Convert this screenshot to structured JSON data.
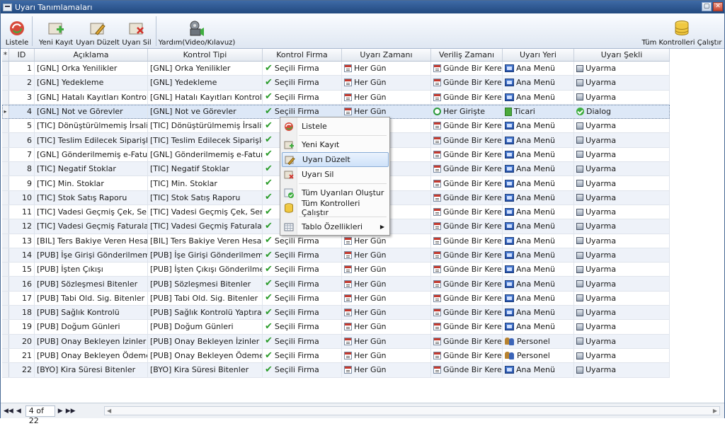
{
  "window": {
    "title": "Uyarı Tanımlamaları"
  },
  "toolbar": {
    "listele": "Listele",
    "yeni_kayit": "Yeni Kayıt",
    "uyari_duzelt": "Uyarı Düzelt",
    "uyari_sil": "Uyarı Sil",
    "yardim": "Yardım(Video/Kılavuz)",
    "tum_kontroller": "Tüm Kontrolleri Çalıştır"
  },
  "grid": {
    "new_row_marker": "*",
    "current_row_marker": "▸",
    "columns": [
      "ID",
      "Açıklama",
      "Kontrol Tipi",
      "Kontrol Firma",
      "Uyarı Zamanı",
      "Veriliş Zamanı",
      "Uyarı Yeri",
      "Uyarı Şekli"
    ],
    "rows": [
      {
        "id": "1",
        "aciklama": "[GNL] Orka Yenilikler",
        "tip": "[GNL] Orka Yenilikler",
        "firma": "Seçili Firma",
        "zaman": "Her Gün",
        "verilis": "Günde Bir Kere",
        "yer": "Ana Menü",
        "sekil": "Uyarma"
      },
      {
        "id": "2",
        "aciklama": "[GNL] Yedekleme",
        "tip": "[GNL] Yedekleme",
        "firma": "Seçili Firma",
        "zaman": "Her Gün",
        "verilis": "Günde Bir Kere",
        "yer": "Ana Menü",
        "sekil": "Uyarma"
      },
      {
        "id": "3",
        "aciklama": "[GNL] Hatalı Kayıtları Kontrol Et",
        "tip": "[GNL] Hatalı Kayıtları Kontrol Et",
        "firma": "Seçili Firma",
        "zaman": "Her Gün",
        "verilis": "Günde Bir Kere",
        "yer": "Ana Menü",
        "sekil": "Uyarma"
      },
      {
        "id": "4",
        "aciklama": "[GNL] Not ve Görevler",
        "tip": "[GNL] Not ve Görevler",
        "firma": "Seçili Firma",
        "zaman": "Her Gün",
        "verilis": "Her Girişte",
        "yer": "Ticari",
        "sekil": "Dialog"
      },
      {
        "id": "5",
        "aciklama": "[TIC] Dönüştürülmemiş İrsaliyeler",
        "tip": "[TIC] Dönüştürülmemiş İrsaliyeler",
        "firma": "",
        "zaman": "",
        "verilis": "Günde Bir Kere",
        "yer": "Ana Menü",
        "sekil": "Uyarma"
      },
      {
        "id": "6",
        "aciklama": "[TIC] Teslim Edilecek Siparişler",
        "tip": "[TIC] Teslim Edilecek Siparişler",
        "firma": "",
        "zaman": "",
        "verilis": "Günde Bir Kere",
        "yer": "Ana Menü",
        "sekil": "Uyarma"
      },
      {
        "id": "7",
        "aciklama": "[GNL] Gönderilmemiş e-Faturalar",
        "tip": "[GNL] Gönderilmemiş e-Faturalar",
        "firma": "",
        "zaman": "",
        "verilis": "Günde Bir Kere",
        "yer": "Ana Menü",
        "sekil": "Uyarma"
      },
      {
        "id": "8",
        "aciklama": "[TIC] Negatif Stoklar",
        "tip": "[TIC] Negatif Stoklar",
        "firma": "",
        "zaman": "",
        "verilis": "Günde Bir Kere",
        "yer": "Ana Menü",
        "sekil": "Uyarma"
      },
      {
        "id": "9",
        "aciklama": "[TIC] Min. Stoklar",
        "tip": "[TIC] Min. Stoklar",
        "firma": "",
        "zaman": "",
        "verilis": "Günde Bir Kere",
        "yer": "Ana Menü",
        "sekil": "Uyarma"
      },
      {
        "id": "10",
        "aciklama": "[TIC] Stok Satış Raporu",
        "tip": "[TIC] Stok Satış Raporu",
        "firma": "",
        "zaman": "",
        "verilis": "Günde Bir Kere",
        "yer": "Ana Menü",
        "sekil": "Uyarma"
      },
      {
        "id": "11",
        "aciklama": "[TIC] Vadesi Geçmiş Çek, Senet",
        "tip": "[TIC] Vadesi Geçmiş Çek, Senet",
        "firma": "",
        "zaman": "",
        "verilis": "Günde Bir Kere",
        "yer": "Ana Menü",
        "sekil": "Uyarma"
      },
      {
        "id": "12",
        "aciklama": "[TIC] Vadesi Geçmiş Faturalar",
        "tip": "[TIC] Vadesi Geçmiş Faturalar",
        "firma": "",
        "zaman": "",
        "verilis": "Günde Bir Kere",
        "yer": "Ana Menü",
        "sekil": "Uyarma"
      },
      {
        "id": "13",
        "aciklama": "[BIL] Ters Bakiye Veren Hesaplar",
        "tip": "[BIL] Ters Bakiye Veren Hesaplar",
        "firma": "Seçili Firma",
        "zaman": "Her Gün",
        "verilis": "Günde Bir Kere",
        "yer": "Ana Menü",
        "sekil": "Uyarma"
      },
      {
        "id": "14",
        "aciklama": "[PUB] İşe Girişi Gönderilmemişler",
        "tip": "[PUB] İşe Girişi Gönderilmemişler",
        "firma": "Seçili Firma",
        "zaman": "Her Gün",
        "verilis": "Günde Bir Kere",
        "yer": "Ana Menü",
        "sekil": "Uyarma"
      },
      {
        "id": "15",
        "aciklama": "[PUB] İşten Çıkışı",
        "tip": "[PUB] İşten Çıkışı Gönderilmemişle",
        "firma": "Seçili Firma",
        "zaman": "Her Gün",
        "verilis": "Günde Bir Kere",
        "yer": "Ana Menü",
        "sekil": "Uyarma"
      },
      {
        "id": "16",
        "aciklama": "[PUB] Sözleşmesi Bitenler",
        "tip": "[PUB] Sözleşmesi Bitenler",
        "firma": "Seçili Firma",
        "zaman": "Her Gün",
        "verilis": "Günde Bir Kere",
        "yer": "Ana Menü",
        "sekil": "Uyarma"
      },
      {
        "id": "17",
        "aciklama": "[PUB] Tabi Old. Sig. Bitenler",
        "tip": "[PUB] Tabi Old. Sig. Bitenler",
        "firma": "Seçili Firma",
        "zaman": "Her Gün",
        "verilis": "Günde Bir Kere",
        "yer": "Ana Menü",
        "sekil": "Uyarma"
      },
      {
        "id": "18",
        "aciklama": "[PUB] Sağlık Kontrolü",
        "tip": "[PUB] Sağlık Kontrolü Yaptıracaklar",
        "firma": "Seçili Firma",
        "zaman": "Her Gün",
        "verilis": "Günde Bir Kere",
        "yer": "Ana Menü",
        "sekil": "Uyarma"
      },
      {
        "id": "19",
        "aciklama": "[PUB] Doğum Günleri",
        "tip": "[PUB] Doğum Günleri",
        "firma": "Seçili Firma",
        "zaman": "Her Gün",
        "verilis": "Günde Bir Kere",
        "yer": "Ana Menü",
        "sekil": "Uyarma"
      },
      {
        "id": "20",
        "aciklama": "[PUB] Onay Bekleyen İzinler",
        "tip": "[PUB] Onay Bekleyen İzinler",
        "firma": "Seçili Firma",
        "zaman": "Her Gün",
        "verilis": "Günde Bir Kere",
        "yer": "Personel",
        "sekil": "Uyarma"
      },
      {
        "id": "21",
        "aciklama": "[PUB] Onay Bekleyen Ödemeler",
        "tip": "[PUB] Onay Bekleyen Ödemeler",
        "firma": "Seçili Firma",
        "zaman": "Her Gün",
        "verilis": "Günde Bir Kere",
        "yer": "Personel",
        "sekil": "Uyarma"
      },
      {
        "id": "22",
        "aciklama": "[BYO] Kira Süresi Bitenler",
        "tip": "[BYO] Kira Süresi Bitenler",
        "firma": "Seçili Firma",
        "zaman": "Her Gün",
        "verilis": "Günde Bir Kere",
        "yer": "Ana Menü",
        "sekil": "Uyarma"
      }
    ]
  },
  "context_menu": {
    "listele": "Listele",
    "yeni_kayit": "Yeni Kayıt",
    "uyari_duzelt": "Uyarı Düzelt",
    "uyari_sil": "Uyarı Sil",
    "tum_uyarilari": "Tüm Uyarıları Oluştur",
    "tum_kontroller": "Tüm Kontrolleri Çalıştır",
    "tablo": "Tablo Özellikleri"
  },
  "status": {
    "pager": "4 of 22"
  }
}
